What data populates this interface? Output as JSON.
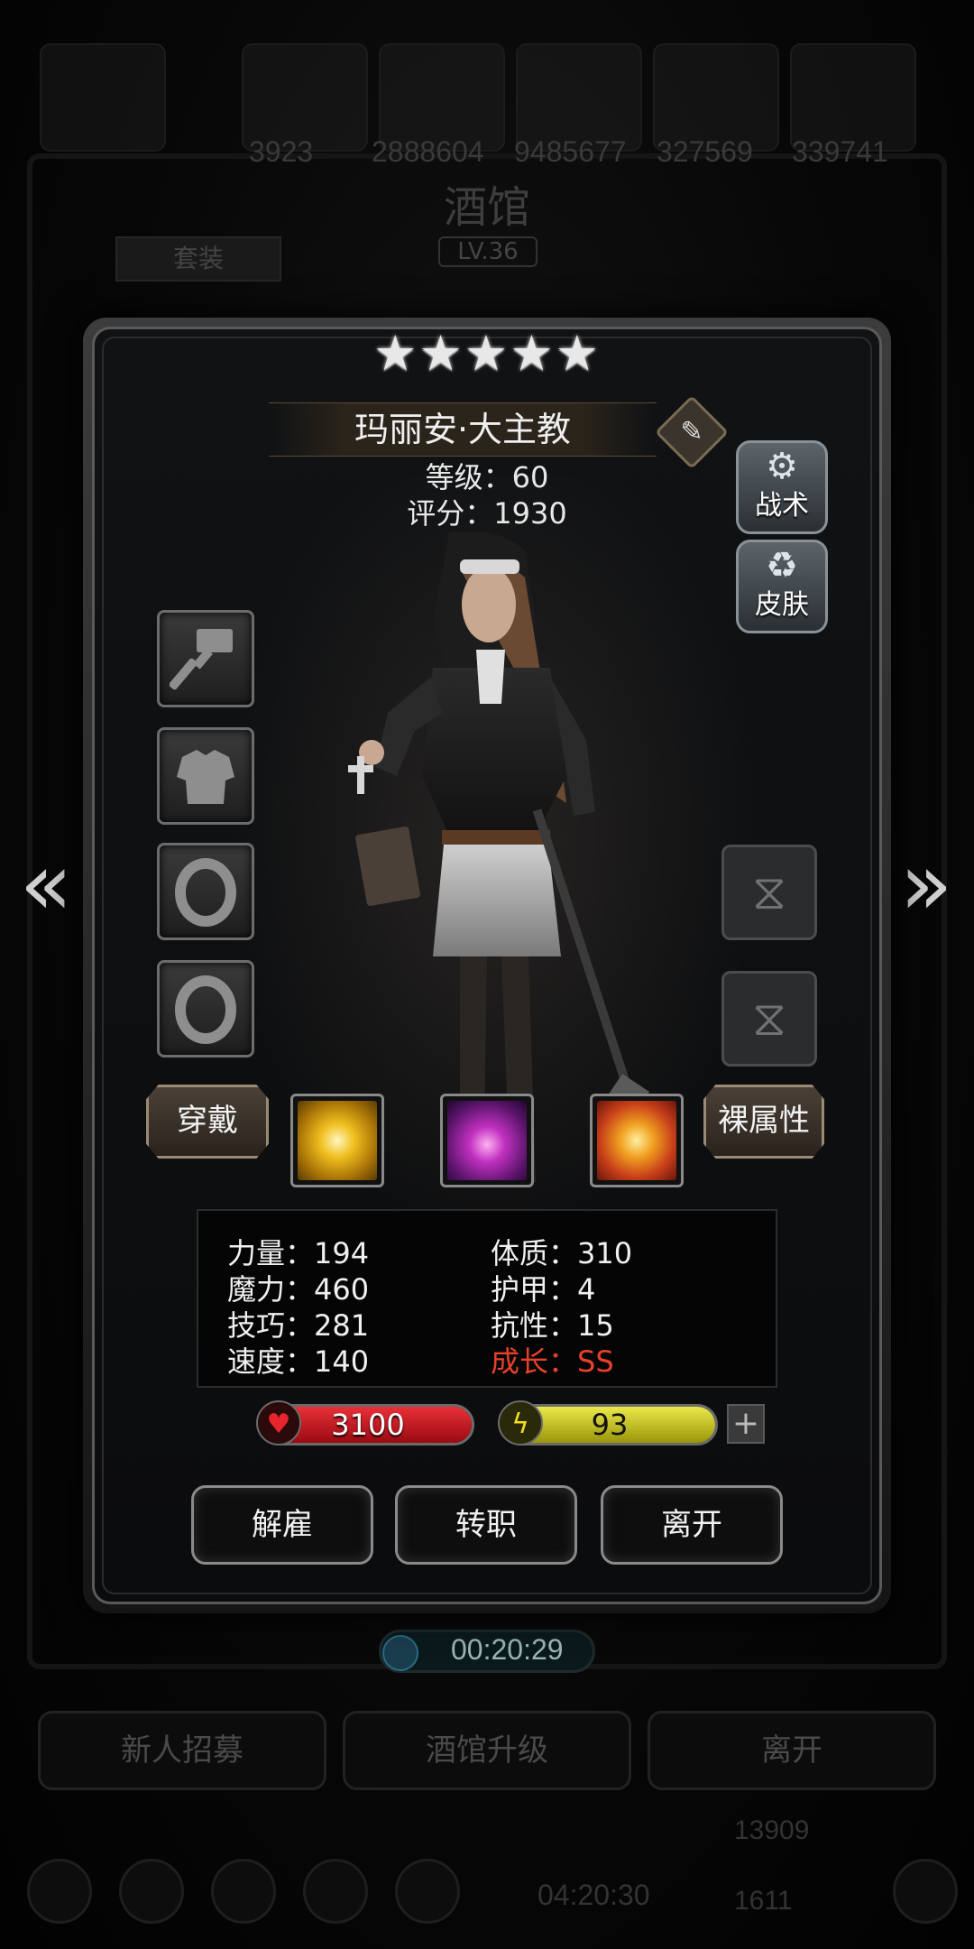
{
  "background": {
    "resources": [
      "3923",
      "2888604",
      "9485677",
      "327569",
      "339741"
    ],
    "title": "酒馆",
    "level": "LV.36",
    "suit_tab": "套装",
    "timer": "00:20:29",
    "bottom_buttons": [
      "新人招募",
      "酒馆升级",
      "离开"
    ],
    "timer2": "04:20:30",
    "count1": "13909",
    "count2": "1611"
  },
  "hero": {
    "stars": "★★★★★",
    "name": "玛丽安·大主教",
    "level_text": "等级：60",
    "score_text": "评分：1930"
  },
  "side_buttons": {
    "tactic": "战术",
    "skin": "皮肤"
  },
  "buttons": {
    "wear": "穿戴",
    "naked_attr": "裸属性",
    "fire": "解雇",
    "transfer": "转职",
    "leave": "离开"
  },
  "stats": {
    "strength": "力量：194",
    "magic": "魔力：460",
    "skill": "技巧：281",
    "speed": "速度：140",
    "constitution": "体质：310",
    "armor": "护甲：4",
    "resistance": "抗性：15",
    "growth": "成长：SS"
  },
  "bars": {
    "hp": "3100",
    "energy": "93"
  },
  "icons": {
    "prev": "chevron-left-icon",
    "next": "chevron-right-icon",
    "gear": "gear-icon",
    "skin": "shirt-icon",
    "hammer": "hammer-icon",
    "armor": "armor-icon",
    "ring": "ring-icon",
    "hourglass": "hourglass-icon",
    "heart": "heart-icon",
    "bolt": "lightning-icon"
  },
  "colors": {
    "hp_bar": "#c4141c",
    "energy_bar": "#c8c420",
    "growth_text": "#e8412b"
  }
}
